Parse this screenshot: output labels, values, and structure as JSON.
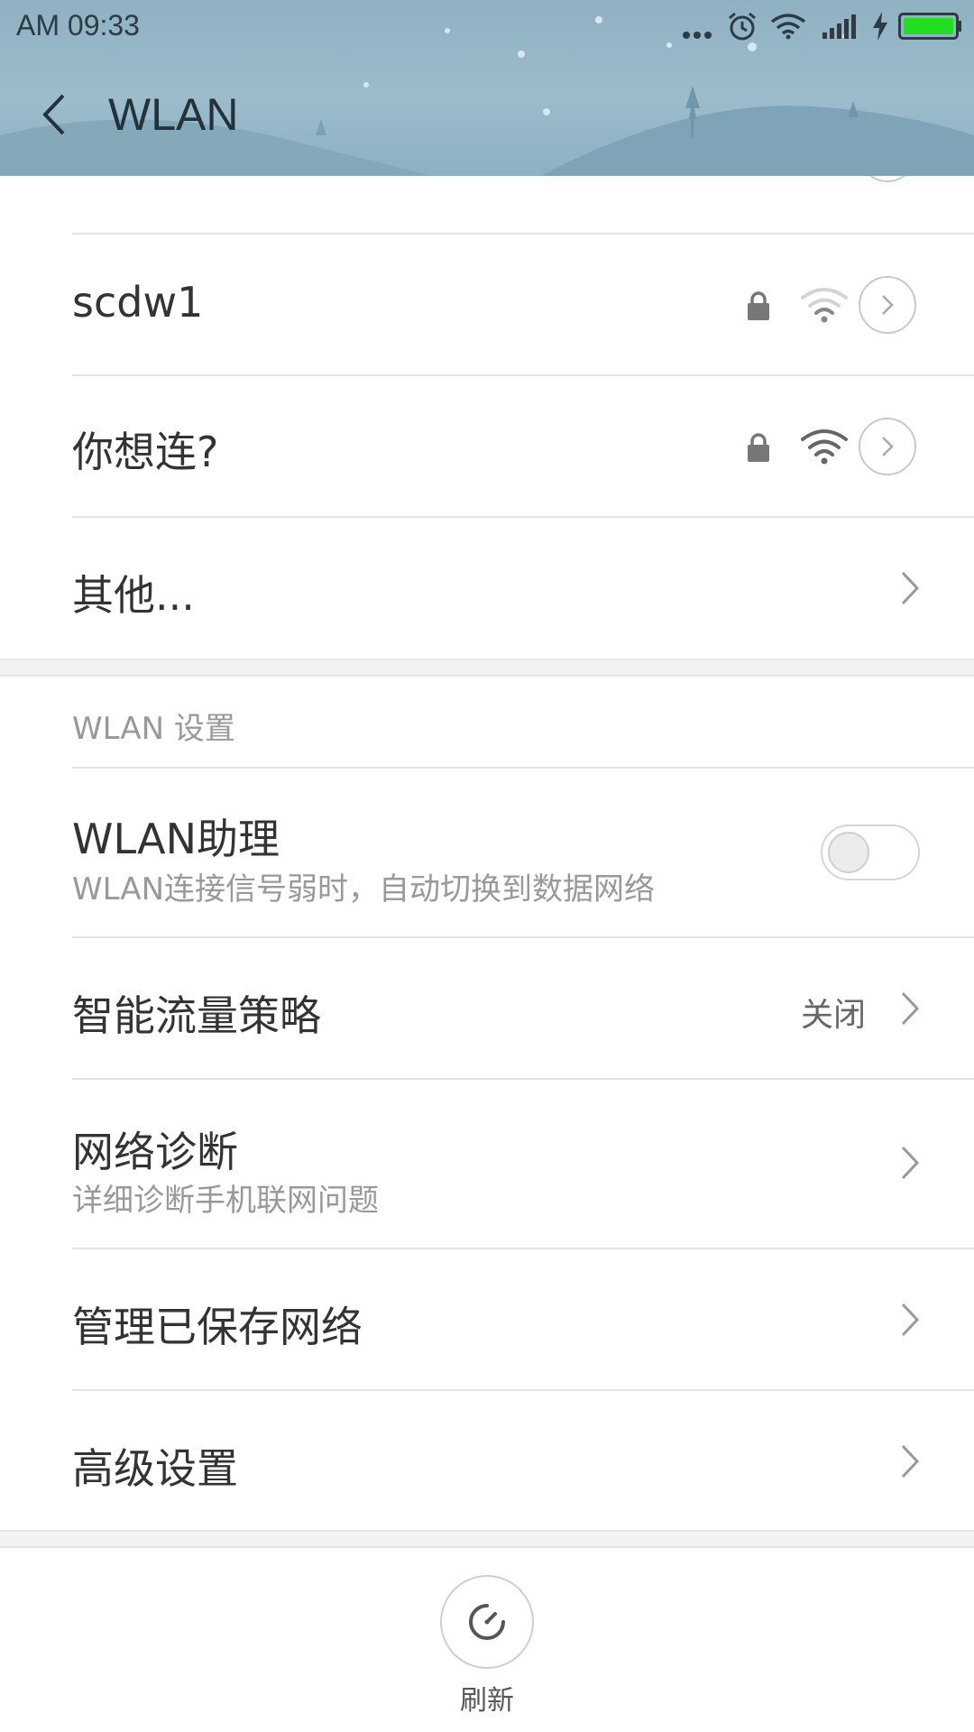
{
  "status_bar": {
    "time": "AM  09:33"
  },
  "header": {
    "title": "WLAN"
  },
  "networks": [
    {
      "name": "scdw1",
      "secured": true,
      "signal": "weak"
    },
    {
      "name": "你想连?",
      "secured": true,
      "signal": "strong"
    }
  ],
  "other_item": {
    "label": "其他..."
  },
  "settings_section": {
    "header": "WLAN 设置",
    "wlan_assistant": {
      "title": "WLAN助理",
      "subtitle": "WLAN连接信号弱时，自动切换到数据网络",
      "enabled": false
    },
    "smart_traffic": {
      "title": "智能流量策略",
      "value": "关闭"
    },
    "network_diagnosis": {
      "title": "网络诊断",
      "subtitle": "详细诊断手机联网问题"
    },
    "saved_networks": {
      "title": "管理已保存网络"
    },
    "advanced": {
      "title": "高级设置"
    }
  },
  "bottom": {
    "refresh_label": "刷新"
  },
  "colors": {
    "header_bg": "#8fb1c2",
    "battery": "#22dd22"
  }
}
